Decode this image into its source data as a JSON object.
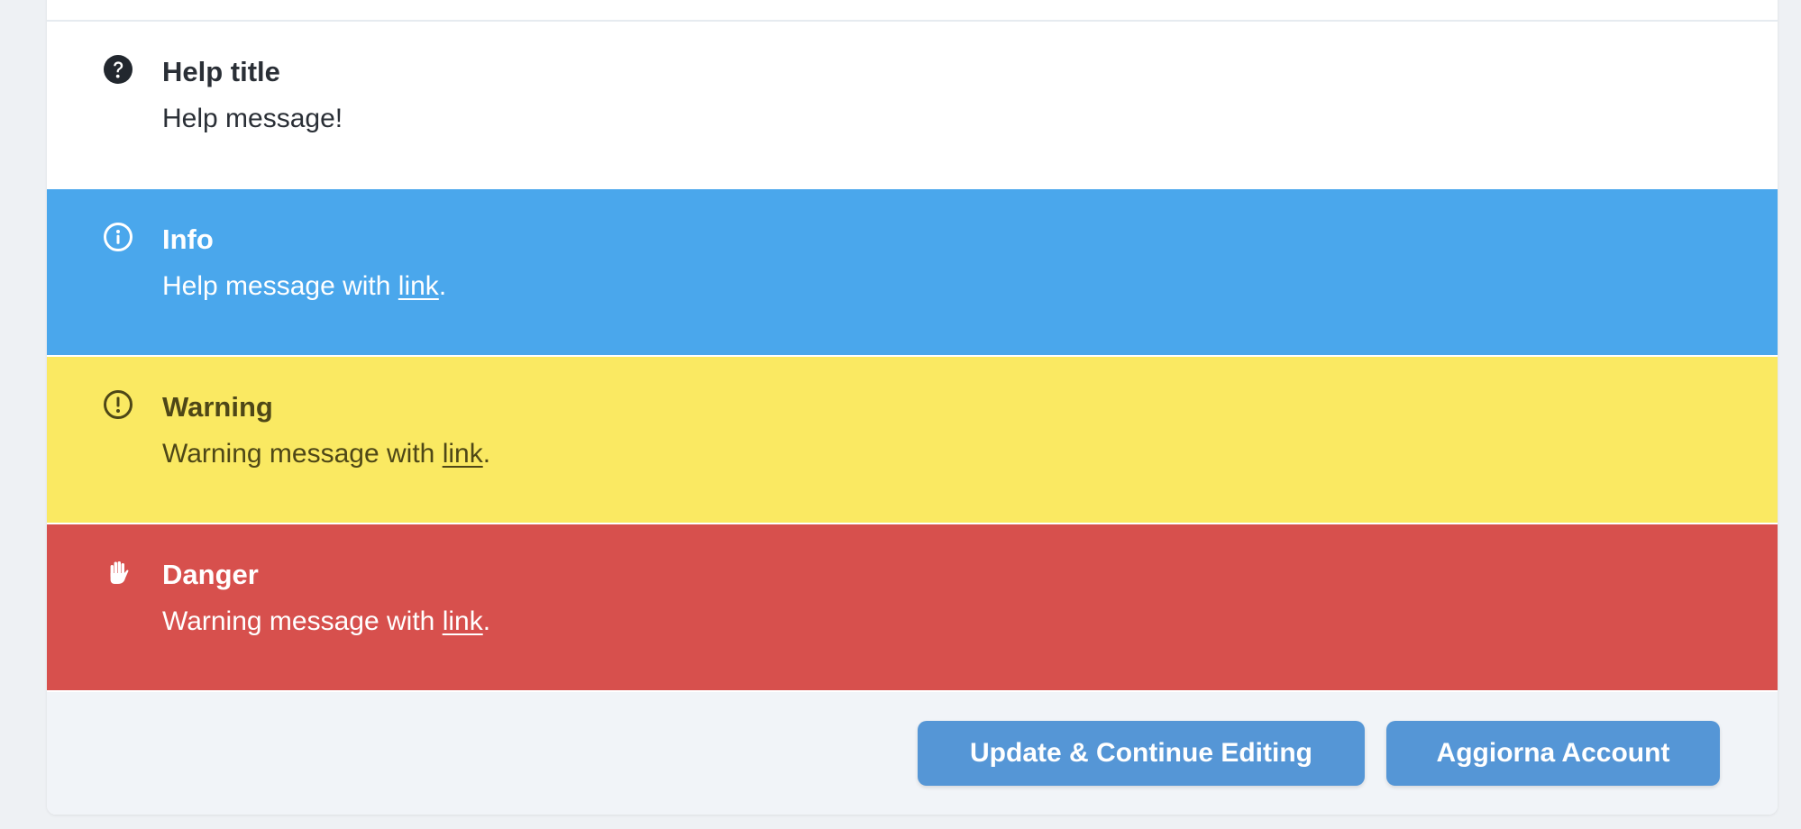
{
  "alerts": {
    "help": {
      "icon": "question-circle-icon",
      "title": "Help title",
      "message": "Help message!"
    },
    "info": {
      "icon": "info-circle-icon",
      "title": "Info",
      "message_prefix": "Help message with ",
      "link_text": "link",
      "message_suffix": ".",
      "color": "#4aa7ec"
    },
    "warning": {
      "icon": "exclamation-circle-icon",
      "title": "Warning",
      "message_prefix": "Warning message with ",
      "link_text": "link",
      "message_suffix": ".",
      "color": "#fae962"
    },
    "danger": {
      "icon": "hand-stop-icon",
      "title": "Danger",
      "message_prefix": "Warning message with ",
      "link_text": "link",
      "message_suffix": ".",
      "color": "#d7504d"
    }
  },
  "footer": {
    "update_continue_label": "Update & Continue Editing",
    "update_account_label": "Aggiorna Account",
    "button_color": "#5596d6"
  }
}
